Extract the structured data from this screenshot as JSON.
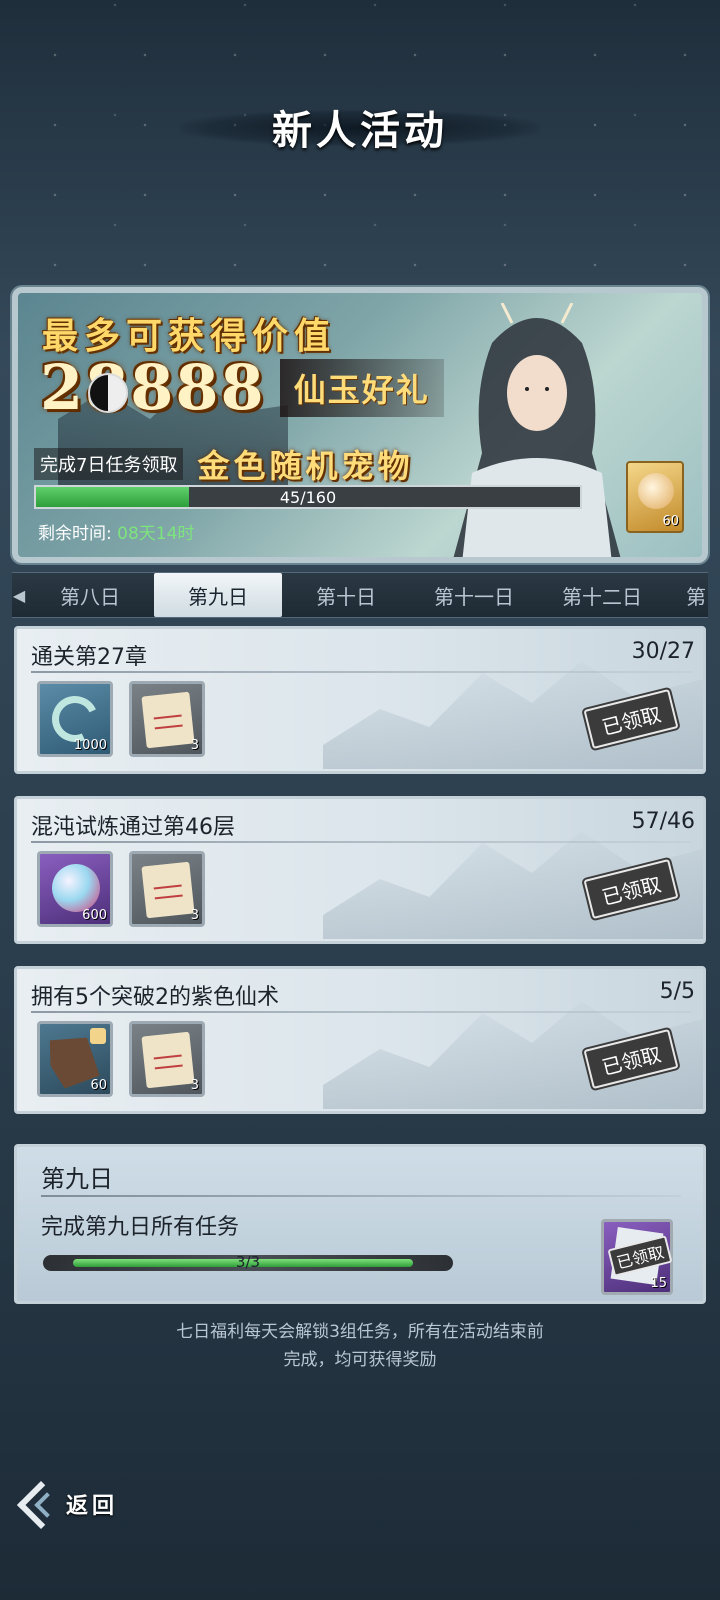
{
  "page": {
    "title": "新人活动"
  },
  "banner": {
    "headline": "最多可获得价值",
    "big_number": "28888",
    "gift_text": "仙玉好礼",
    "task_desc": "完成7日任务领取",
    "pet_text": "金色随机宠物",
    "progress_current": 45,
    "progress_total": 160,
    "progress_text": "45/160",
    "time_label": "剩余时间:",
    "time_value": "08天14时",
    "reward_count": "60",
    "reward_icon": "pet-fragment-icon"
  },
  "tabs": [
    {
      "label": "第八日",
      "active": false
    },
    {
      "label": "第九日",
      "active": true
    },
    {
      "label": "第十日",
      "active": false
    },
    {
      "label": "第十一日",
      "active": false
    },
    {
      "label": "第十二日",
      "active": false
    },
    {
      "label": "第",
      "active": false
    }
  ],
  "tasks": [
    {
      "title": "通关第27章",
      "count": "30/27",
      "status": "已领取",
      "rewards": [
        {
          "icon": "swirl-icon",
          "qty": "1000",
          "color": "blue"
        },
        {
          "icon": "scroll-icon",
          "qty": "3",
          "color": "gray"
        }
      ]
    },
    {
      "title": "混沌试炼通过第46层",
      "count": "57/46",
      "status": "已领取",
      "rewards": [
        {
          "icon": "orb-icon",
          "qty": "600",
          "color": "purple"
        },
        {
          "icon": "scroll-icon",
          "qty": "3",
          "color": "gray"
        }
      ]
    },
    {
      "title": "拥有5个突破2的紫色仙术",
      "count": "5/5",
      "status": "已领取",
      "rewards": [
        {
          "icon": "map-fragment-icon",
          "qty": "60",
          "color": "bluegray"
        },
        {
          "icon": "scroll-icon",
          "qty": "3",
          "color": "gray"
        }
      ]
    }
  ],
  "summary": {
    "title": "第九日",
    "desc": "完成第九日所有任务",
    "progress_current": 3,
    "progress_total": 3,
    "progress_text": "3/3",
    "reward_status": "已领取",
    "reward_qty": "15"
  },
  "footer": {
    "line1": "七日福利每天会解锁3组任务，所有在活动结束前",
    "line2": "完成，均可获得奖励"
  },
  "back": {
    "label": "返回"
  }
}
